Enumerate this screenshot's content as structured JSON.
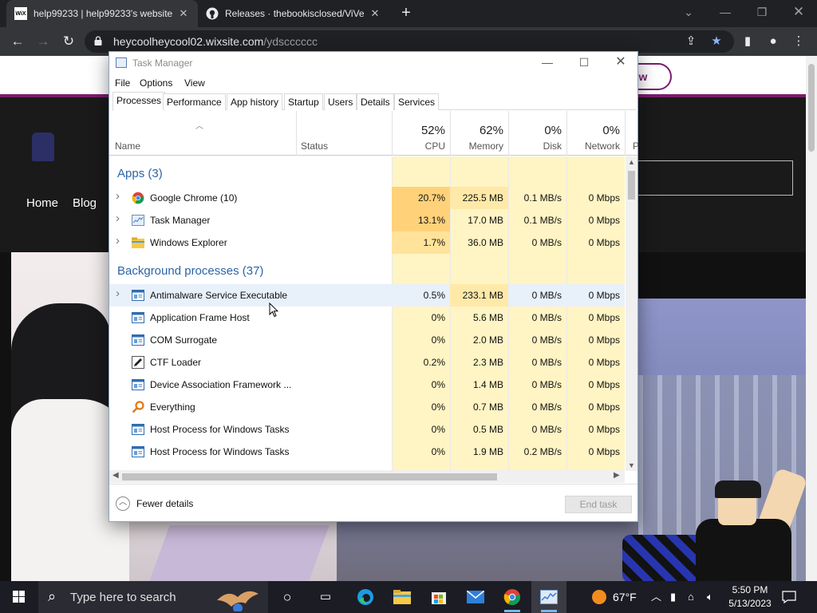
{
  "browser": {
    "tabs": [
      {
        "title": "help99233 | help99233's website",
        "favicon": "WiX"
      },
      {
        "title": "Releases · thebookisclosed/ViVe"
      }
    ],
    "url_host": "heycoolheycool02.wixsite.com",
    "url_path": "/ydscccccc"
  },
  "website": {
    "follow_button": "ow",
    "nav": [
      "Home",
      "Blog"
    ]
  },
  "task_manager": {
    "title": "Task Manager",
    "menu": [
      "File",
      "Options",
      "View"
    ],
    "tabs": [
      "Processes",
      "Performance",
      "App history",
      "Startup",
      "Users",
      "Details",
      "Services"
    ],
    "active_tab": "Processes",
    "columns": {
      "name": "Name",
      "status": "Status",
      "cpu": {
        "pct": "52%",
        "label": "CPU"
      },
      "memory": {
        "pct": "62%",
        "label": "Memory"
      },
      "disk": {
        "pct": "0%",
        "label": "Disk"
      },
      "network": {
        "pct": "0%",
        "label": "Network"
      },
      "power_partial": "P"
    },
    "groups": {
      "apps": "Apps (3)",
      "background": "Background processes (37)"
    },
    "apps": [
      {
        "name": "Google Chrome (10)",
        "icon": "chrome-icon",
        "cpu": "20.7%",
        "memory": "225.5 MB",
        "disk": "0.1 MB/s",
        "network": "0 Mbps"
      },
      {
        "name": "Task Manager",
        "icon": "task-manager-icon",
        "cpu": "13.1%",
        "memory": "17.0 MB",
        "disk": "0.1 MB/s",
        "network": "0 Mbps"
      },
      {
        "name": "Windows Explorer",
        "icon": "folder-icon",
        "cpu": "1.7%",
        "memory": "36.0 MB",
        "disk": "0 MB/s",
        "network": "0 Mbps"
      }
    ],
    "background": [
      {
        "name": "Antimalware Service Executable",
        "icon": "service-icon",
        "cpu": "0.5%",
        "memory": "233.1 MB",
        "disk": "0 MB/s",
        "network": "0 Mbps"
      },
      {
        "name": "Application Frame Host",
        "icon": "service-icon",
        "cpu": "0%",
        "memory": "5.6 MB",
        "disk": "0 MB/s",
        "network": "0 Mbps"
      },
      {
        "name": "COM Surrogate",
        "icon": "service-icon",
        "cpu": "0%",
        "memory": "2.0 MB",
        "disk": "0 MB/s",
        "network": "0 Mbps"
      },
      {
        "name": "CTF Loader",
        "icon": "pen-icon",
        "cpu": "0.2%",
        "memory": "2.3 MB",
        "disk": "0 MB/s",
        "network": "0 Mbps"
      },
      {
        "name": "Device Association Framework ...",
        "icon": "service-icon",
        "cpu": "0%",
        "memory": "1.4 MB",
        "disk": "0 MB/s",
        "network": "0 Mbps"
      },
      {
        "name": "Everything",
        "icon": "magnifier-icon",
        "cpu": "0%",
        "memory": "0.7 MB",
        "disk": "0 MB/s",
        "network": "0 Mbps"
      },
      {
        "name": "Host Process for Windows Tasks",
        "icon": "service-icon",
        "cpu": "0%",
        "memory": "0.5 MB",
        "disk": "0 MB/s",
        "network": "0 Mbps"
      },
      {
        "name": "Host Process for Windows Tasks",
        "icon": "service-icon",
        "cpu": "0%",
        "memory": "1.9 MB",
        "disk": "0.2 MB/s",
        "network": "0 Mbps"
      }
    ],
    "footer": {
      "fewer_details": "Fewer details",
      "end_task": "End task"
    }
  },
  "taskbar": {
    "search_placeholder": "Type here to search",
    "weather": "67°F",
    "time": "5:50 PM",
    "date": "5/13/2023"
  },
  "colors": {
    "heat_light": "#fff4c4",
    "heat_mid": "#ffe9a8",
    "heat_cpu_high": "#ffd27a",
    "heat_cpu_mid": "#ffe39b",
    "group_blue": "#2c64a6",
    "site_accent": "#7a1c6c"
  }
}
